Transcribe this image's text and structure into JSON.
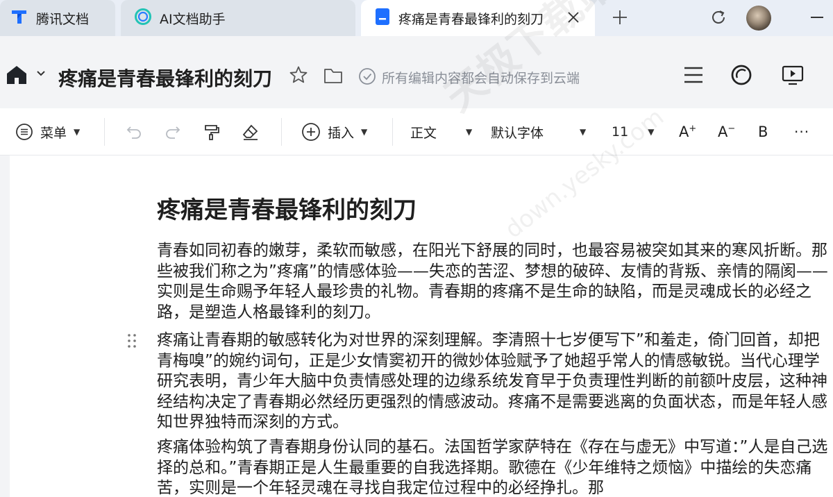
{
  "browser": {
    "tabs": [
      {
        "title": "腾讯文档",
        "icon": "tencent-docs-icon",
        "active": false
      },
      {
        "title": "AI文档助手",
        "icon": "ai-assistant-icon",
        "active": false
      },
      {
        "title": "疼痛是青春最锋利的刻刀",
        "icon": "document-icon",
        "active": true
      }
    ],
    "new_tab_icon": "plus-icon",
    "reload_icon": "reload-icon",
    "window_control": "minimize-icon"
  },
  "header": {
    "doc_title": "疼痛是青春最锋利的刻刀",
    "save_status": "所有编辑内容都会自动保存到云端",
    "icons": [
      "home-icon",
      "chevron-down-icon",
      "star-icon",
      "folder-icon",
      "check-circle-icon",
      "menu-lines-icon",
      "assistant-icon",
      "present-icon"
    ]
  },
  "toolbar": {
    "menu_label": "菜单",
    "insert_label": "插入",
    "style_value": "正文",
    "font_value": "默认字体",
    "size_value": "11",
    "increase_font": "A",
    "decrease_font": "A",
    "bold_label": "B",
    "more_label": "···"
  },
  "document": {
    "title": "疼痛是青春最锋利的刻刀",
    "paragraphs": [
      "青春如同初春的嫩芽，柔软而敏感，在阳光下舒展的同时，也最容易被突如其来的寒风折断。那些被我们称之为”疼痛”的情感体验——失恋的苦涩、梦想的破碎、友情的背叛、亲情的隔阂——实则是生命赐予年轻人最珍贵的礼物。青春期的疼痛不是生命的缺陷，而是灵魂成长的必经之路，是塑造人格最锋利的刻刀。",
      "疼痛让青春期的敏感转化为对世界的深刻理解。李清照十七岁便写下”和羞走，倚门回首，却把青梅嗅”的婉约词句，正是少女情窦初开的微妙体验赋予了她超乎常人的情感敏锐。当代心理学研究表明，青少年大脑中负责情感处理的边缘系统发育早于负责理性判断的前额叶皮层，这种神经结构决定了青春期必然经历更强烈的情感波动。疼痛不是需要逃离的负面状态，而是年轻人感知世界独特而深刻的方式。",
      "疼痛体验构筑了青春期身份认同的基石。法国哲学家萨特在《存在与虚无》中写道：”人是自己选择的总和。”青春期正是人生最重要的自我选择期。歌德在《少年维特之烦恼》中描绘的失恋痛苦，实则是一个年轻灵魂在寻找自我定位过程中的必经挣扎。那"
    ]
  },
  "watermark": {
    "text": "天极下载站",
    "url": "down.yesky.com"
  },
  "colors": {
    "tab_bar_bg": "#e9eef6",
    "header_bg": "#f3f4f6",
    "accent_blue": "#1e6fff",
    "ai_teal": "#22c3b5",
    "muted_text": "#8a8f98"
  }
}
